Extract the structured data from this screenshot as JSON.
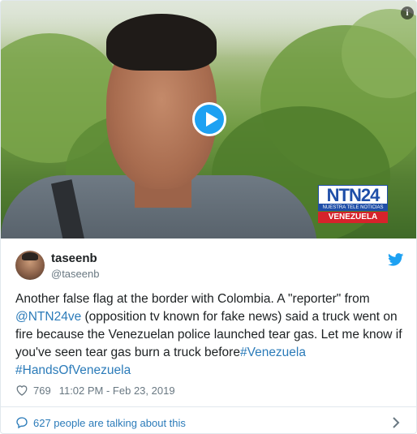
{
  "media": {
    "info_icon_glyph": "i",
    "watermark": {
      "brand": "NTN24",
      "tagline": "NUESTRA TELE NOTICIAS",
      "region": "VENEZUELA"
    }
  },
  "tweet": {
    "display_name": "taseenb",
    "handle": "@taseenb",
    "text_parts": {
      "p1": "Another false flag at the border with Colombia. A \"reporter\" from ",
      "mention": "@NTN24ve",
      "p2": " (opposition tv known for fake news) said a truck went on fire because the Venezuelan police launched tear gas. Let me know if you've seen tear gas burn a truck before",
      "hashtag1": "#Venezuela",
      "hashtag2": "#HandsOfVenezuela"
    },
    "likes": "769",
    "timestamp": "11:02 PM - Feb 23, 2019"
  },
  "footer": {
    "talking_label": "627 people are talking about this"
  },
  "colors": {
    "twitter_blue": "#1da1f2",
    "link_blue": "#2b7bb9",
    "meta_gray": "#697882",
    "ntn_blue": "#1e4ea8",
    "ntn_red": "#d6232b"
  }
}
